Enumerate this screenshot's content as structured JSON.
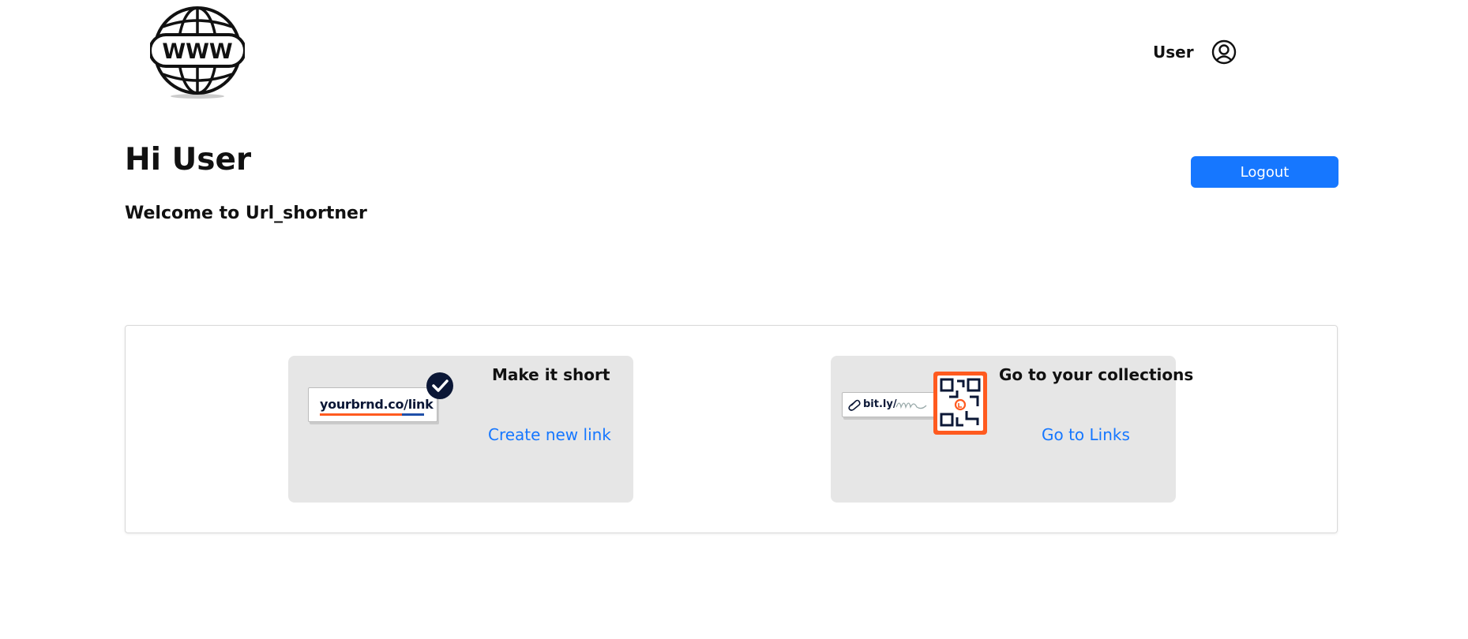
{
  "header": {
    "logo_text": "WWW",
    "logo_icon": "globe-www-icon",
    "user_label": "User",
    "user_icon": "user-circle-icon"
  },
  "main": {
    "greeting": "Hi User",
    "welcome": "Welcome to Url_shortner",
    "logout_label": "Logout"
  },
  "cards": [
    {
      "title": "Make it short",
      "link": "Create new link",
      "illustration_text": "yourbrnd.co/link",
      "illustration_icon": "verified-check-icon"
    },
    {
      "title": "Go to your collections",
      "link": "Go to Links",
      "illustration_text": "bit.ly/",
      "illustration_icon": "qr-code-icon"
    }
  ],
  "colors": {
    "primary": "#1677ff",
    "card_bg": "#e6e6e6",
    "accent_orange": "#ff5a1f",
    "navy": "#0b1736"
  }
}
